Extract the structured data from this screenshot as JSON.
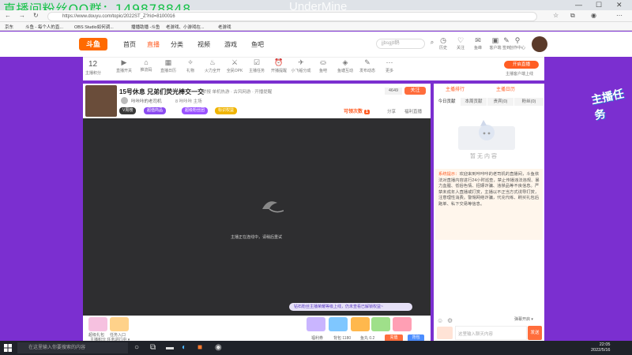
{
  "overlay": {
    "qq": "直播间粉丝QQ群：149878848",
    "watermark": "UnderMine"
  },
  "browser": {
    "url": "https://www.douyu.com/topic/2022ST_Z?rid=8100016",
    "bookmarks": [
      "京东",
      "斗鱼 - 每个人的直...",
      "OBS Studio如何调...",
      "播播助播 -斗鱼",
      "老游戏、小游戏在...",
      "老游戏"
    ]
  },
  "header": {
    "logo": "斗鱼",
    "nav": [
      "首页",
      "直播",
      "分类",
      "视频",
      "游戏",
      "鱼吧"
    ],
    "search_placeholder": "jjbsgjtl鹅",
    "icons": [
      {
        "label": "历史",
        "icon": "history-icon"
      },
      {
        "label": "关注",
        "icon": "follow-icon"
      },
      {
        "label": "鱼峰",
        "icon": "fish-icon"
      },
      {
        "label": "客户端",
        "icon": "client-icon"
      },
      {
        "label": "签到",
        "icon": "signin-icon"
      },
      {
        "label": "创作中心",
        "icon": "creator-icon"
      }
    ]
  },
  "toolbar": {
    "level": "12",
    "level_label": "主播积分",
    "items": [
      {
        "label": "直播开关",
        "icon": "live-switch-icon"
      },
      {
        "label": "推流码",
        "icon": "stream-key-icon"
      },
      {
        "label": "直播日历",
        "icon": "calendar-icon"
      },
      {
        "label": "礼物",
        "icon": "gift-icon"
      },
      {
        "label": "火力全开",
        "icon": "fire-icon"
      },
      {
        "label": "全民OPK",
        "icon": "pk-icon"
      },
      {
        "label": "主播任务",
        "icon": "task-icon"
      },
      {
        "label": "开播提醒",
        "icon": "alarm-icon"
      },
      {
        "label": "小飞船分成",
        "icon": "ship-icon"
      },
      {
        "label": "鱼吧",
        "icon": "fishbar-icon"
      },
      {
        "label": "鱼塘互动",
        "icon": "game-icon"
      },
      {
        "label": "发布动态",
        "icon": "post-icon"
      },
      {
        "label": "更多",
        "icon": "more-icon"
      }
    ],
    "open_btn": "开启直播",
    "download_link": "主播客户端上线"
  },
  "room": {
    "title": "15号休息 兄弟们荧光棒交一交",
    "meta": "举报  单机热游 · 古风网游 · 开播提醒",
    "owner": "咔咔咔的老司机",
    "owner_extra": "8   咔咔咔  主场",
    "tags": [
      "V周榜",
      "超值商品",
      "超级粉丝团",
      "标识权益"
    ],
    "subscribers": "4649",
    "subscribe_btn": "关注",
    "reward": "可领次数",
    "reward_count": "1",
    "share": "分享",
    "report": "福利直播"
  },
  "video": {
    "message": "主播正在连线中，请稍后重试",
    "banner": "钻石粉丝主播荣耀等级上线，仍未查看已解锁权益~"
  },
  "gifts": {
    "left": [
      "超级礼包",
      "任务入口"
    ],
    "left_bottom": "主播积分 任务进行中 ▾",
    "right": [
      "福利券",
      "背包 1180",
      "鱼丸 0.2"
    ],
    "btn1": "充值",
    "btn2": "背包"
  },
  "side": {
    "tabs_top": [
      "主播排行",
      "主播日历"
    ],
    "tabs": [
      "今日贡献",
      "本周贡献",
      "贵宾(0)",
      "粉丝(0)"
    ],
    "empty": "暂无内容",
    "notice_label": "系统提示：",
    "notice": "欢迎来到咔咔咔的老司机的直播间，斗鱼依法对直播内容进行24小时巡查，禁止传播违法违规、暴力血腥、低俗色情、招嫖诈骗、违禁品等不良信息。严禁未成年人直播或打赏，主播以不正当方式诱导打赏，注意理性消费。警惕网络诈骗，代充代练、刷买礼包后跑单、私下交易等信息。",
    "barrage": "弹幕开启 ▾",
    "chat_placeholder": "这里输入聊天内容",
    "send": "发送"
  },
  "promo": "主播任务",
  "taskbar": {
    "search": "在这里输入你要搜索的内容",
    "time": "22:05",
    "date": "2022/5/16"
  }
}
